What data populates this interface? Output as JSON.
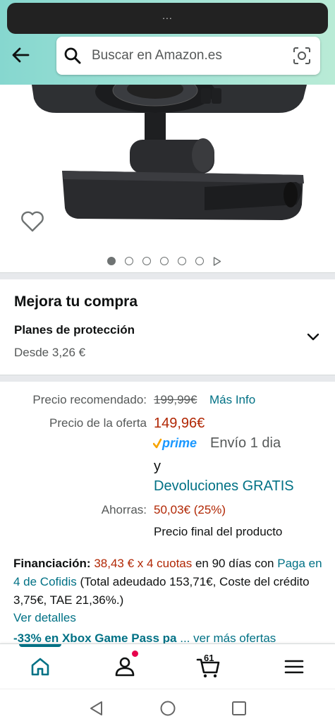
{
  "browser": {
    "url_pill": "..."
  },
  "header": {
    "search_placeholder": "Buscar en Amazon.es"
  },
  "product": {
    "images_count": 7,
    "active_image_index": 0
  },
  "upgrade": {
    "title": "Mejora tu compra",
    "plans_title": "Planes de protección",
    "plans_from": "Desde 3,26 €"
  },
  "pricing": {
    "recommended_label": "Precio recomendado:",
    "recommended_price": "199,99€",
    "more_info": "Más Info",
    "offer_label": "Precio de la oferta",
    "offer_price": "149,96€",
    "prime_logo": "prime",
    "shipping": "Envío 1 dia",
    "and": "y",
    "returns": "Devoluciones GRATIS",
    "savings_label": "Ahorras:",
    "savings_value": "50,03€ (25%)",
    "final_price_note": "Precio final del producto"
  },
  "financing": {
    "label": "Financiación:",
    "amount": "38,43 € x 4 cuotas",
    "text1": " en 90 días con ",
    "provider": "Paga en 4 de Cofidis",
    "text2": " (Total adeudado 153,71€, Coste del crédito 3,75€, TAE 21,36%.)",
    "details": "Ver detalles"
  },
  "promo": {
    "text": "-33% en Xbox Game Pass pa",
    "more": "... ver más ofertas"
  },
  "bottom_nav": {
    "cart_count": "61"
  },
  "colors": {
    "link": "#007185",
    "price_red": "#b12704",
    "header_gradient_start": "#86d7cf",
    "header_gradient_end": "#b9ebd6"
  }
}
